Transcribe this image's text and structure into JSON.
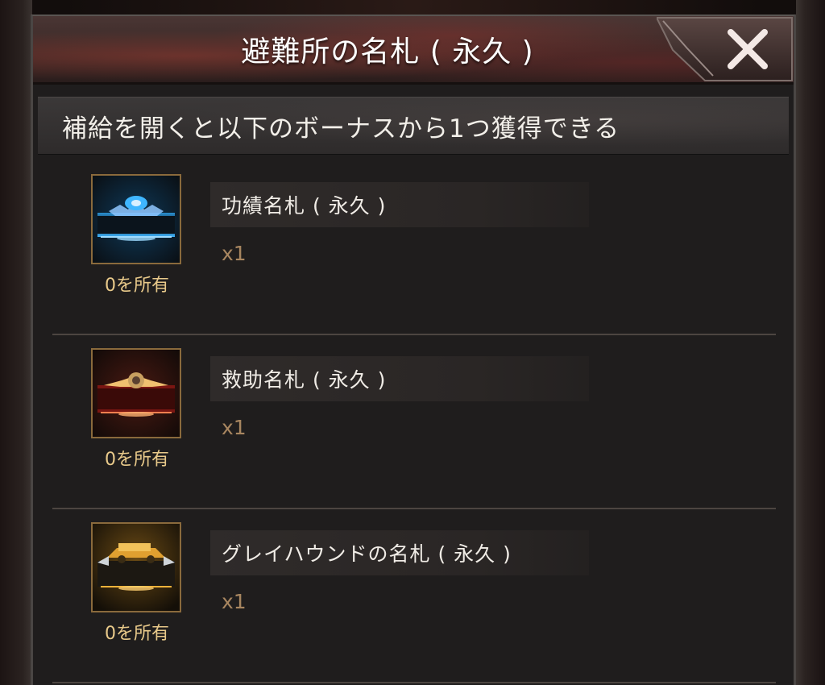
{
  "dialog": {
    "title": "避難所の名札 ( 永久 )",
    "close_icon": "close-x-icon",
    "subtitle": "補給を開くと以下のボーナスから1つ獲得できる"
  },
  "items": [
    {
      "name": "功績名札 ( 永久 )",
      "quantity": "x1",
      "owned": "0を所有",
      "icon": "blue-emblem-nameplate-icon",
      "accent_color": "#3fb6ff"
    },
    {
      "name": "救助名札 ( 永久 )",
      "quantity": "x1",
      "owned": "0を所有",
      "icon": "red-emblem-nameplate-icon",
      "accent_color": "#e0503a"
    },
    {
      "name": "グレイハウンドの名札 ( 永久 )",
      "quantity": "x1",
      "owned": "0を所有",
      "icon": "gold-vehicle-nameplate-icon",
      "accent_color": "#f2b23a"
    }
  ]
}
